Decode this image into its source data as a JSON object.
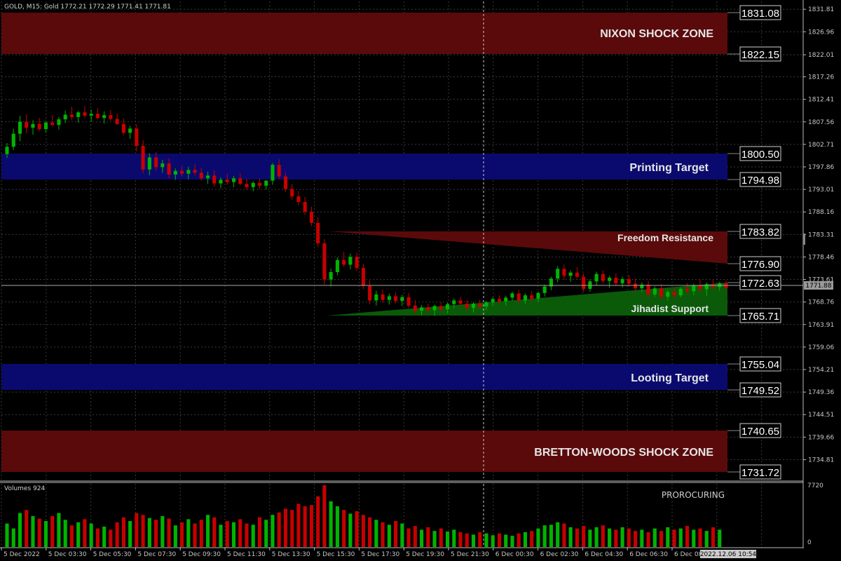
{
  "header": {
    "info": "GOLD, M15:  Gold  1772.21 1772.29 1771.41 1771.81"
  },
  "colors": {
    "background": "#000000",
    "grid": "#3a3a3a",
    "bull": "#00b400",
    "bear": "#c80000",
    "shock_zone": "#5a0a0a",
    "target_zone": "#0a0a6e",
    "support_zone": "#0a5a0a",
    "price_line": "#aaaaaa"
  },
  "price_axis": {
    "ticks": [
      "1831.81",
      "1826.96",
      "1822.01",
      "1817.26",
      "1812.41",
      "1807.56",
      "1802.71",
      "1797.86",
      "1793.01",
      "1788.16",
      "1783.31",
      "1778.46",
      "1773.61",
      "1768.76",
      "1763.91",
      "1759.06",
      "1754.21",
      "1749.36",
      "1744.51",
      "1739.66",
      "1734.81"
    ],
    "current_price": "1771.88"
  },
  "zones": {
    "nixon": {
      "label": "NIXON SHOCK ZONE",
      "top": "1831.08",
      "bottom": "1822.15"
    },
    "printing": {
      "label": "Printing Target",
      "top": "1800.50",
      "bottom": "1794.98"
    },
    "freedom": {
      "label": "Freedom Resistance",
      "top": "1783.82",
      "bottom": "1776.90"
    },
    "jihadist": {
      "label": "Jihadist Support",
      "top": "1772.63",
      "bottom": "1765.71"
    },
    "looting": {
      "label": "Looting Target",
      "top": "1755.04",
      "bottom": "1749.52"
    },
    "bretton": {
      "label": "BRETTON-WOODS SHOCK ZONE",
      "top": "1740.65",
      "bottom": "1731.72"
    }
  },
  "volumes": {
    "title": "Volumes 924",
    "indicator_label": "PROROCURING",
    "max_label": "7720",
    "min_label": "0"
  },
  "time_axis": {
    "ticks": [
      "5 Dec 2022",
      "5 Dec 03:30",
      "5 Dec 05:30",
      "5 Dec 07:30",
      "5 Dec 09:30",
      "5 Dec 11:30",
      "5 Dec 13:30",
      "5 Dec 15:30",
      "5 Dec 17:30",
      "5 Dec 19:30",
      "5 Dec 21:30",
      "6 Dec 00:30",
      "6 Dec 02:30",
      "6 Dec 04:30",
      "6 Dec 06:30",
      "6 Dec 08:30"
    ],
    "cursor_time": "2022.12.06 10:54"
  },
  "chart_data": {
    "type": "candlestick",
    "symbol": "GOLD",
    "timeframe": "M15",
    "ylim": [
      1730.5,
      1833.2
    ],
    "ohlc": [
      [
        1800.6,
        1803.0,
        1799.8,
        1802.2
      ],
      [
        1802.2,
        1806.1,
        1801.5,
        1805.0
      ],
      [
        1805.0,
        1808.8,
        1803.4,
        1807.6
      ],
      [
        1807.6,
        1809.2,
        1805.1,
        1806.3
      ],
      [
        1806.3,
        1807.9,
        1804.8,
        1807.1
      ],
      [
        1807.1,
        1808.4,
        1805.6,
        1806.0
      ],
      [
        1806.0,
        1807.7,
        1805.2,
        1807.4
      ],
      [
        1807.4,
        1809.0,
        1806.5,
        1806.9
      ],
      [
        1806.9,
        1808.6,
        1805.9,
        1808.1
      ],
      [
        1808.1,
        1810.0,
        1807.3,
        1809.1
      ],
      [
        1809.1,
        1810.8,
        1808.0,
        1808.6
      ],
      [
        1808.6,
        1809.9,
        1807.4,
        1809.6
      ],
      [
        1809.6,
        1811.0,
        1808.4,
        1808.9
      ],
      [
        1808.9,
        1810.2,
        1807.6,
        1809.3
      ],
      [
        1809.3,
        1810.5,
        1808.1,
        1808.4
      ],
      [
        1808.4,
        1809.8,
        1807.2,
        1809.0
      ],
      [
        1809.0,
        1810.1,
        1807.8,
        1808.2
      ],
      [
        1808.2,
        1809.4,
        1806.9,
        1807.1
      ],
      [
        1807.1,
        1808.3,
        1804.7,
        1805.2
      ],
      [
        1805.2,
        1806.7,
        1803.9,
        1806.1
      ],
      [
        1806.1,
        1807.0,
        1801.2,
        1802.4
      ],
      [
        1802.4,
        1803.6,
        1796.5,
        1797.3
      ],
      [
        1797.3,
        1800.8,
        1796.1,
        1799.9
      ],
      [
        1799.9,
        1801.0,
        1797.0,
        1797.8
      ],
      [
        1797.8,
        1799.4,
        1796.6,
        1798.6
      ],
      [
        1798.6,
        1799.7,
        1795.4,
        1796.2
      ],
      [
        1796.2,
        1797.5,
        1795.1,
        1797.0
      ],
      [
        1797.0,
        1798.1,
        1795.8,
        1796.4
      ],
      [
        1796.4,
        1797.9,
        1795.2,
        1797.2
      ],
      [
        1797.2,
        1798.4,
        1796.0,
        1796.6
      ],
      [
        1796.6,
        1797.7,
        1794.9,
        1795.4
      ],
      [
        1795.4,
        1796.8,
        1794.2,
        1796.0
      ],
      [
        1796.0,
        1797.1,
        1793.6,
        1794.3
      ],
      [
        1794.3,
        1795.6,
        1793.2,
        1795.1
      ],
      [
        1795.1,
        1796.4,
        1794.0,
        1794.6
      ],
      [
        1794.6,
        1795.9,
        1793.5,
        1795.4
      ],
      [
        1795.4,
        1796.5,
        1793.9,
        1794.2
      ],
      [
        1794.2,
        1795.3,
        1792.9,
        1793.5
      ],
      [
        1793.5,
        1794.8,
        1792.6,
        1794.4
      ],
      [
        1794.4,
        1795.4,
        1793.1,
        1793.8
      ],
      [
        1793.8,
        1795.0,
        1793.0,
        1794.9
      ],
      [
        1794.9,
        1798.7,
        1794.0,
        1798.3
      ],
      [
        1798.3,
        1799.5,
        1795.2,
        1795.8
      ],
      [
        1795.8,
        1796.6,
        1792.4,
        1793.1
      ],
      [
        1793.1,
        1794.2,
        1790.8,
        1791.5
      ],
      [
        1791.5,
        1792.7,
        1789.6,
        1790.3
      ],
      [
        1790.3,
        1791.4,
        1787.5,
        1788.2
      ],
      [
        1788.2,
        1789.3,
        1785.1,
        1785.8
      ],
      [
        1785.8,
        1787.0,
        1780.6,
        1781.4
      ],
      [
        1781.4,
        1782.3,
        1772.5,
        1773.6
      ],
      [
        1773.6,
        1776.0,
        1772.1,
        1775.2
      ],
      [
        1775.2,
        1778.4,
        1774.5,
        1777.8
      ],
      [
        1777.8,
        1779.6,
        1776.3,
        1776.8
      ],
      [
        1776.8,
        1779.2,
        1775.8,
        1778.5
      ],
      [
        1778.5,
        1779.4,
        1775.5,
        1776.1
      ],
      [
        1776.1,
        1777.0,
        1771.5,
        1772.2
      ],
      [
        1772.2,
        1773.4,
        1768.3,
        1769.1
      ],
      [
        1769.1,
        1771.2,
        1768.0,
        1770.4
      ],
      [
        1770.4,
        1771.5,
        1768.6,
        1769.2
      ],
      [
        1769.2,
        1770.6,
        1768.2,
        1770.0
      ],
      [
        1770.0,
        1770.9,
        1768.5,
        1769.0
      ],
      [
        1769.0,
        1770.3,
        1767.9,
        1769.8
      ],
      [
        1769.8,
        1770.7,
        1767.5,
        1768.0
      ],
      [
        1768.0,
        1769.2,
        1766.3,
        1766.9
      ],
      [
        1766.9,
        1768.1,
        1765.9,
        1767.6
      ],
      [
        1767.6,
        1768.4,
        1766.4,
        1767.0
      ],
      [
        1767.0,
        1768.2,
        1765.8,
        1767.9
      ],
      [
        1767.9,
        1768.7,
        1766.6,
        1767.2
      ],
      [
        1767.2,
        1768.6,
        1766.3,
        1768.3
      ],
      [
        1768.3,
        1769.5,
        1767.4,
        1769.1
      ],
      [
        1769.1,
        1769.9,
        1767.9,
        1768.4
      ],
      [
        1768.4,
        1769.2,
        1766.8,
        1767.5
      ],
      [
        1767.5,
        1768.7,
        1766.5,
        1768.4
      ],
      [
        1768.4,
        1769.3,
        1767.2,
        1767.8
      ],
      [
        1767.8,
        1769.0,
        1767.0,
        1768.7
      ],
      [
        1768.7,
        1769.8,
        1767.9,
        1769.4
      ],
      [
        1769.4,
        1770.2,
        1768.3,
        1768.9
      ],
      [
        1768.9,
        1770.1,
        1768.0,
        1769.7
      ],
      [
        1769.7,
        1771.0,
        1769.0,
        1770.6
      ],
      [
        1770.6,
        1771.4,
        1768.5,
        1769.1
      ],
      [
        1769.1,
        1770.6,
        1768.4,
        1770.2
      ],
      [
        1770.2,
        1771.1,
        1768.9,
        1769.5
      ],
      [
        1769.5,
        1771.0,
        1768.7,
        1770.7
      ],
      [
        1770.7,
        1772.5,
        1770.0,
        1772.1
      ],
      [
        1772.1,
        1774.2,
        1771.3,
        1773.8
      ],
      [
        1773.8,
        1776.5,
        1773.0,
        1775.9
      ],
      [
        1775.9,
        1776.8,
        1773.6,
        1774.4
      ],
      [
        1774.4,
        1775.6,
        1773.1,
        1775.1
      ],
      [
        1775.1,
        1776.3,
        1773.8,
        1774.2
      ],
      [
        1774.2,
        1775.0,
        1770.9,
        1771.6
      ],
      [
        1771.6,
        1773.6,
        1771.0,
        1773.2
      ],
      [
        1773.2,
        1775.3,
        1772.4,
        1774.8
      ],
      [
        1774.8,
        1775.6,
        1772.7,
        1773.3
      ],
      [
        1773.3,
        1774.4,
        1771.8,
        1774.0
      ],
      [
        1774.0,
        1774.9,
        1772.2,
        1772.8
      ],
      [
        1772.8,
        1774.2,
        1771.9,
        1773.7
      ],
      [
        1773.7,
        1774.6,
        1772.1,
        1772.7
      ],
      [
        1772.7,
        1773.8,
        1771.1,
        1771.7
      ],
      [
        1771.7,
        1773.0,
        1770.9,
        1772.5
      ],
      [
        1772.5,
        1773.3,
        1769.8,
        1770.4
      ],
      [
        1770.4,
        1772.1,
        1769.9,
        1771.7
      ],
      [
        1771.7,
        1772.6,
        1769.3,
        1769.9
      ],
      [
        1769.9,
        1771.4,
        1769.1,
        1770.9
      ],
      [
        1770.9,
        1772.0,
        1769.5,
        1770.2
      ],
      [
        1770.2,
        1771.9,
        1769.8,
        1771.6
      ],
      [
        1771.6,
        1772.8,
        1770.6,
        1771.1
      ],
      [
        1771.1,
        1772.7,
        1770.2,
        1772.4
      ],
      [
        1772.4,
        1773.5,
        1771.0,
        1771.5
      ],
      [
        1771.5,
        1773.0,
        1770.1,
        1772.6
      ],
      [
        1772.6,
        1773.6,
        1771.4,
        1772.0
      ],
      [
        1772.0,
        1773.1,
        1771.2,
        1772.8
      ],
      [
        1772.8,
        1773.4,
        1771.4,
        1771.8
      ]
    ],
    "volumes": [
      38,
      30,
      55,
      60,
      50,
      46,
      42,
      50,
      55,
      44,
      35,
      40,
      45,
      38,
      30,
      33,
      28,
      40,
      48,
      42,
      55,
      52,
      47,
      44,
      50,
      46,
      35,
      40,
      45,
      38,
      44,
      52,
      48,
      36,
      42,
      40,
      45,
      38,
      36,
      48,
      44,
      52,
      56,
      62,
      60,
      70,
      66,
      68,
      82,
      100,
      74,
      66,
      60,
      54,
      58,
      52,
      48,
      44,
      40,
      36,
      42,
      38,
      30,
      34,
      28,
      32,
      26,
      30,
      25,
      28,
      24,
      22,
      20,
      24,
      22,
      19,
      22,
      20,
      18,
      22,
      24,
      26,
      30,
      35,
      36,
      40,
      38,
      32,
      30,
      34,
      28,
      32,
      35,
      30,
      28,
      32,
      30,
      26,
      28,
      24,
      30,
      26,
      32,
      28,
      30,
      34,
      28,
      30,
      26,
      32,
      28
    ],
    "annotations": [
      "NIXON SHOCK ZONE",
      "Printing Target",
      "Freedom Resistance",
      "Jihadist Support",
      "Looting Target",
      "BRETTON-WOODS SHOCK ZONE"
    ]
  }
}
